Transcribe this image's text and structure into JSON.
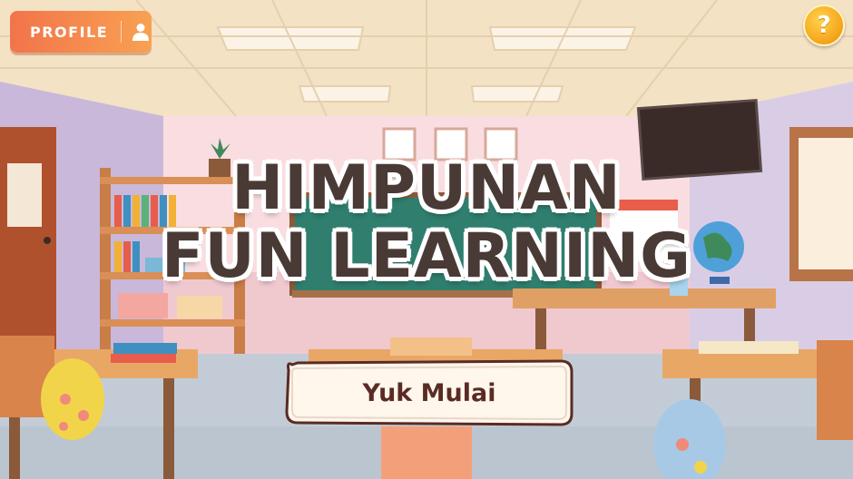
{
  "profile_button": {
    "label": "PROFILE",
    "icon": "user-icon"
  },
  "help_button": {
    "glyph": "?",
    "icon": "question-icon"
  },
  "title": {
    "line1": "HIMPUNAN",
    "line2": "FUN LEARNING"
  },
  "start_button": {
    "label": "Yuk Mulai"
  },
  "colors": {
    "accent": "#f2744a",
    "title_text": "#4a3a36",
    "help": "#f4a318",
    "button_text": "#5a2b24"
  }
}
